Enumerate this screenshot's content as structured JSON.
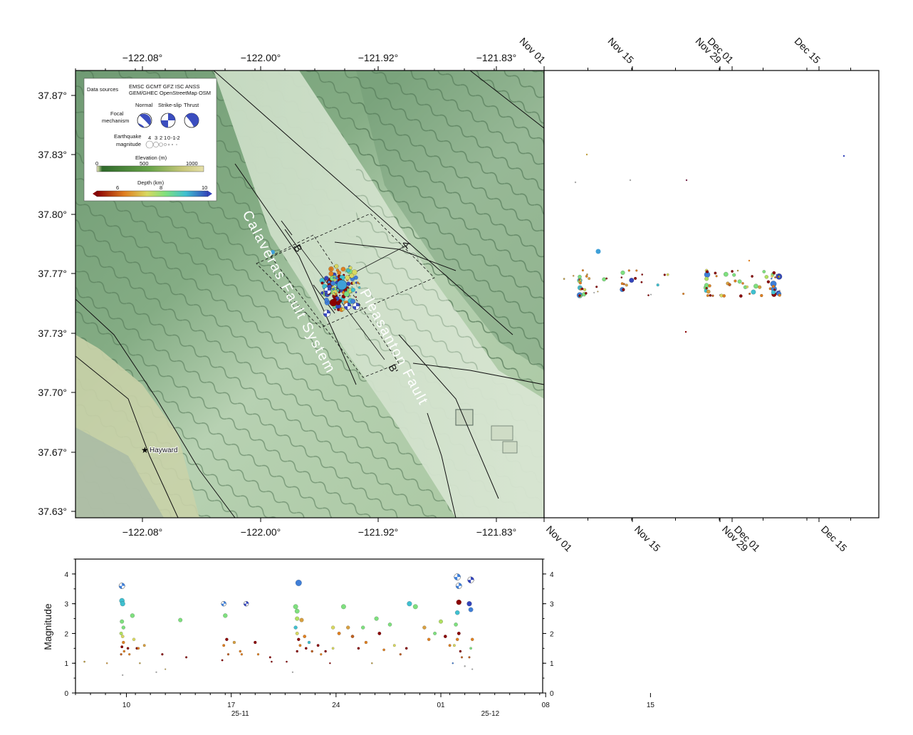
{
  "map": {
    "lon_ticks": [
      "−122.08°",
      "−122.00°",
      "−121.92°",
      "−121.83°"
    ],
    "lat_ticks": [
      "37.87°",
      "37.83°",
      "37.80°",
      "37.77°",
      "37.73°",
      "37.70°",
      "37.67°",
      "37.63°"
    ],
    "fault_labels": [
      "Calaveras Fault System",
      "Pleasanton Fault"
    ],
    "profile_labels": [
      "A",
      "A'",
      "B",
      "B'"
    ],
    "city": "Hayward",
    "colors": {
      "fault": "#111111",
      "profile_box": "#111111"
    }
  },
  "legend": {
    "data_sources_label": "Data sources",
    "data_sources_line1": "EMSC GCMT GFZ ISC ANSS",
    "data_sources_line2": "GEM/GHEC OpenStreetMap OSM",
    "focal_label_1": "Focal",
    "focal_label_2": "mechanism",
    "mech_types": [
      "Normal",
      "Strike-slip",
      "Thrust"
    ],
    "mag_label_1": "Earthquake",
    "mag_label_2": "magnitude",
    "mag_values": [
      "4",
      "3",
      "2",
      "1",
      "0",
      "-1",
      "-2"
    ],
    "elev_title": "Elevation (m)",
    "elev_ticks": [
      "0",
      "500",
      "1000"
    ],
    "depth_title": "Depth (km)",
    "depth_ticks": [
      "6",
      "8",
      "10"
    ]
  },
  "time_panel": {
    "date_ticks": [
      "Nov 01",
      "Nov 15",
      "Nov 29",
      "Dec 01",
      "Dec 15"
    ]
  },
  "chart_data": {
    "type": "scatter",
    "ylabel": "Magnitude",
    "ylim": [
      0,
      4.5
    ],
    "y_ticks": [
      "0",
      "1",
      "2",
      "3",
      "4"
    ],
    "x_ticks": [
      "10",
      "17",
      "24",
      "01",
      "08",
      "15"
    ],
    "x_month_labels": [
      "25-11",
      "25-12"
    ],
    "xlim_day_offset": [
      -6.4,
      24.8
    ],
    "depth_colorscale": [
      "#8b0000",
      "#e08020",
      "#d8d860",
      "#7ee07e",
      "#3fc0d0",
      "#3f7fd8",
      "#3344bb"
    ],
    "events": [
      {
        "d": -5.8,
        "m": 1.05,
        "c": "#c0a040"
      },
      {
        "d": -4.3,
        "m": 1.0,
        "c": "#d8a040"
      },
      {
        "d": -3.3,
        "m": 3.6,
        "c": "#3f7fd8",
        "mech": true
      },
      {
        "d": -3.3,
        "m": 3.1,
        "c": "#3fc0d0"
      },
      {
        "d": -3.25,
        "m": 3.0,
        "c": "#3fc0d0"
      },
      {
        "d": -3.3,
        "m": 2.4,
        "c": "#7ee07e"
      },
      {
        "d": -3.2,
        "m": 2.2,
        "c": "#7ee07e"
      },
      {
        "d": -3.35,
        "m": 2.0,
        "c": "#b0e060"
      },
      {
        "d": -3.25,
        "m": 1.9,
        "c": "#d8d860"
      },
      {
        "d": -3.2,
        "m": 1.7,
        "c": "#e08020"
      },
      {
        "d": -3.3,
        "m": 1.55,
        "c": "#8b0000"
      },
      {
        "d": -3.15,
        "m": 1.4,
        "c": "#e08020"
      },
      {
        "d": -3.35,
        "m": 1.3,
        "c": "#c06020"
      },
      {
        "d": -3.25,
        "m": 0.6,
        "c": "#aaaaaa"
      },
      {
        "d": -2.9,
        "m": 1.5,
        "c": "#8b0000"
      },
      {
        "d": -2.8,
        "m": 1.3,
        "c": "#e08020"
      },
      {
        "d": -2.6,
        "m": 2.6,
        "c": "#7ee07e"
      },
      {
        "d": -2.5,
        "m": 1.8,
        "c": "#d8d860"
      },
      {
        "d": -2.3,
        "m": 1.5,
        "c": "#8b0000"
      },
      {
        "d": -2.1,
        "m": 1.0,
        "c": "#c0a040"
      },
      {
        "d": -2.2,
        "m": 1.5,
        "c": "#e08020"
      },
      {
        "d": -1.8,
        "m": 1.6,
        "c": "#d8a040"
      },
      {
        "d": -1.0,
        "m": 0.7,
        "c": "#aaaaaa"
      },
      {
        "d": -0.6,
        "m": 1.3,
        "c": "#8b0000"
      },
      {
        "d": -0.4,
        "m": 0.8,
        "c": "#c0a040"
      },
      {
        "d": 0.6,
        "m": 2.45,
        "c": "#7ee07e"
      },
      {
        "d": 1.0,
        "m": 1.2,
        "c": "#8b0000"
      },
      {
        "d": 3.5,
        "m": 3.0,
        "c": "#3f7fd8",
        "mech": true
      },
      {
        "d": 3.6,
        "m": 2.6,
        "c": "#7ee07e"
      },
      {
        "d": 3.7,
        "m": 1.8,
        "c": "#8b0000"
      },
      {
        "d": 3.5,
        "m": 1.6,
        "c": "#e08020"
      },
      {
        "d": 3.8,
        "m": 1.3,
        "c": "#c06020"
      },
      {
        "d": 3.4,
        "m": 1.1,
        "c": "#8b0000"
      },
      {
        "d": 4.2,
        "m": 1.7,
        "c": "#d8a040"
      },
      {
        "d": 4.6,
        "m": 1.4,
        "c": "#e08020"
      },
      {
        "d": 5.0,
        "m": 3.0,
        "c": "#3344bb",
        "mech": true
      },
      {
        "d": 5.6,
        "m": 1.7,
        "c": "#8b0000"
      },
      {
        "d": 5.8,
        "m": 1.3,
        "c": "#e08020"
      },
      {
        "d": 6.6,
        "m": 1.2,
        "c": "#8b0000"
      },
      {
        "d": 6.7,
        "m": 1.05,
        "c": "#8b0000"
      },
      {
        "d": 7.7,
        "m": 1.05,
        "c": "#8b0000"
      },
      {
        "d": 8.1,
        "m": 0.7,
        "c": "#aaaaaa"
      },
      {
        "d": 9.2,
        "m": 1.7,
        "c": "#3fc0d0"
      },
      {
        "d": 10.3,
        "m": 1.4,
        "c": "#8b0000"
      },
      {
        "d": 10.8,
        "m": 1.5,
        "c": "#d8d860"
      },
      {
        "d": 13.3,
        "m": 1.3,
        "c": "#e08020"
      },
      {
        "d": 17.1,
        "m": 3.7,
        "c": "#3f7fd8"
      },
      {
        "d": 16.9,
        "m": 2.9,
        "c": "#7ee07e"
      },
      {
        "d": 17.0,
        "m": 2.75,
        "c": "#7ee07e"
      },
      {
        "d": 17.0,
        "m": 2.5,
        "c": "#b0e060"
      },
      {
        "d": 16.9,
        "m": 2.2,
        "c": "#3fc0d0"
      },
      {
        "d": 17.0,
        "m": 2.0,
        "c": "#d8d860"
      },
      {
        "d": 17.1,
        "m": 1.8,
        "c": "#8b0000"
      },
      {
        "d": 17.2,
        "m": 1.6,
        "c": "#e08020"
      },
      {
        "d": 17.0,
        "m": 1.4,
        "c": "#8b0000"
      },
      {
        "d": 17.3,
        "m": 2.45,
        "c": "#d8a040"
      },
      {
        "d": 17.5,
        "m": 1.9,
        "c": "#e08020"
      },
      {
        "d": 17.6,
        "m": 1.5,
        "c": "#8b0000"
      },
      {
        "d": 18.0,
        "m": 1.4,
        "c": "#c06020"
      },
      {
        "d": 18.4,
        "m": 1.6,
        "c": "#8b0000"
      },
      {
        "d": 18.6,
        "m": 1.3,
        "c": "#e08020"
      },
      {
        "d": 19.2,
        "m": 1.0,
        "c": "#8b0000"
      },
      {
        "d": 19.4,
        "m": 2.2,
        "c": "#d8d860"
      },
      {
        "d": 19.8,
        "m": 2.0,
        "c": "#e08020"
      },
      {
        "d": 20.1,
        "m": 2.9,
        "c": "#7ee07e"
      },
      {
        "d": 20.4,
        "m": 2.2,
        "c": "#d8a040"
      },
      {
        "d": 20.7,
        "m": 1.9,
        "c": "#c06020"
      },
      {
        "d": 21.1,
        "m": 1.5,
        "c": "#8b0000"
      },
      {
        "d": 21.4,
        "m": 2.2,
        "c": "#7ee07e"
      },
      {
        "d": 21.6,
        "m": 1.7,
        "c": "#e08020"
      },
      {
        "d": 22.0,
        "m": 1.0,
        "c": "#c0a040"
      },
      {
        "d": 22.3,
        "m": 2.5,
        "c": "#7ee07e"
      },
      {
        "d": 22.5,
        "m": 2.0,
        "c": "#8b0000"
      },
      {
        "d": 22.8,
        "m": 1.45,
        "c": "#e08020"
      },
      {
        "d": 23.2,
        "m": 2.3,
        "c": "#7ee07e"
      },
      {
        "d": 23.5,
        "m": 1.6,
        "c": "#d8d860"
      },
      {
        "d": 23.9,
        "m": 1.3,
        "c": "#c06020"
      },
      {
        "d": 24.3,
        "m": 1.5,
        "c": "#8b0000"
      },
      {
        "d": 24.5,
        "m": 3.0,
        "c": "#3fc0d0"
      },
      {
        "d": 24.9,
        "m": 2.9,
        "c": "#7ee07e"
      },
      {
        "d": 25.5,
        "m": 2.2,
        "c": "#d8a040"
      },
      {
        "d": 25.8,
        "m": 1.8,
        "c": "#e08020"
      },
      {
        "d": 26.2,
        "m": 2.0,
        "c": "#7ee07e"
      },
      {
        "d": 26.6,
        "m": 2.4,
        "c": "#b0e060"
      },
      {
        "d": 26.9,
        "m": 1.9,
        "c": "#8b0000"
      },
      {
        "d": 27.2,
        "m": 1.6,
        "c": "#e08020"
      },
      {
        "d": 27.7,
        "m": 3.9,
        "c": "#3f7fd8",
        "mech": true
      },
      {
        "d": 27.8,
        "m": 3.6,
        "c": "#3f7fd8",
        "mech": true
      },
      {
        "d": 27.8,
        "m": 3.05,
        "c": "#8b0000"
      },
      {
        "d": 27.7,
        "m": 2.7,
        "c": "#3fc0d0"
      },
      {
        "d": 27.6,
        "m": 2.3,
        "c": "#7ee07e"
      },
      {
        "d": 27.8,
        "m": 2.0,
        "c": "#8b0000"
      },
      {
        "d": 27.7,
        "m": 1.8,
        "c": "#e08020"
      },
      {
        "d": 27.5,
        "m": 1.6,
        "c": "#d8d860"
      },
      {
        "d": 27.9,
        "m": 1.4,
        "c": "#8b0000"
      },
      {
        "d": 28.0,
        "m": 1.2,
        "c": "#c06020"
      },
      {
        "d": 27.4,
        "m": 1.0,
        "c": "#3f7fd8"
      },
      {
        "d": 28.2,
        "m": 0.9,
        "c": "#aaaaaa"
      },
      {
        "d": 28.6,
        "m": 3.8,
        "c": "#3344bb",
        "mech": true
      },
      {
        "d": 28.5,
        "m": 3.0,
        "c": "#3344bb"
      },
      {
        "d": 28.6,
        "m": 2.8,
        "c": "#3f7fd8"
      },
      {
        "d": 28.7,
        "m": 1.8,
        "c": "#e08020"
      },
      {
        "d": 28.6,
        "m": 1.5,
        "c": "#7ee07e"
      },
      {
        "d": 28.5,
        "m": 1.2,
        "c": "#c06020"
      },
      {
        "d": 28.7,
        "m": 0.8,
        "c": "#aaaaaa"
      }
    ]
  }
}
